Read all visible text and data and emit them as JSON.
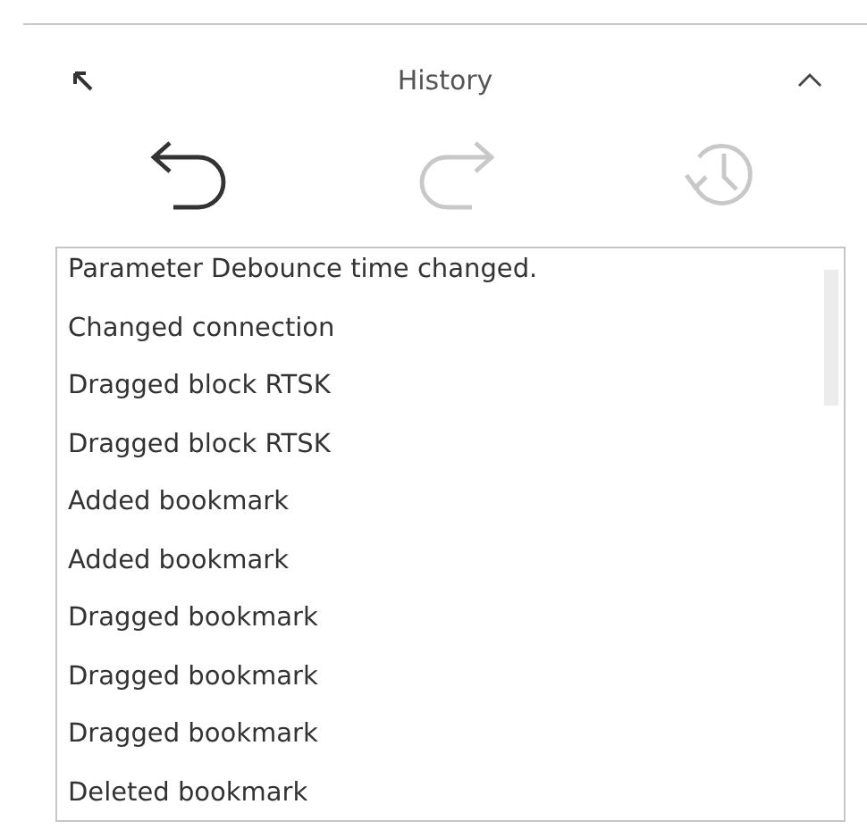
{
  "panel": {
    "title": "History",
    "expanded": true
  },
  "toolbar": [
    {
      "kind": "undo",
      "disabled": false
    },
    {
      "kind": "redo",
      "disabled": true
    },
    {
      "kind": "restore",
      "disabled": true
    }
  ],
  "history": [
    "Parameter Debounce time changed.",
    "Changed connection",
    "Dragged block RTSK",
    "Dragged block RTSK",
    "Added bookmark",
    "Added bookmark",
    "Dragged bookmark",
    "Dragged bookmark",
    "Dragged bookmark",
    "Deleted bookmark"
  ]
}
